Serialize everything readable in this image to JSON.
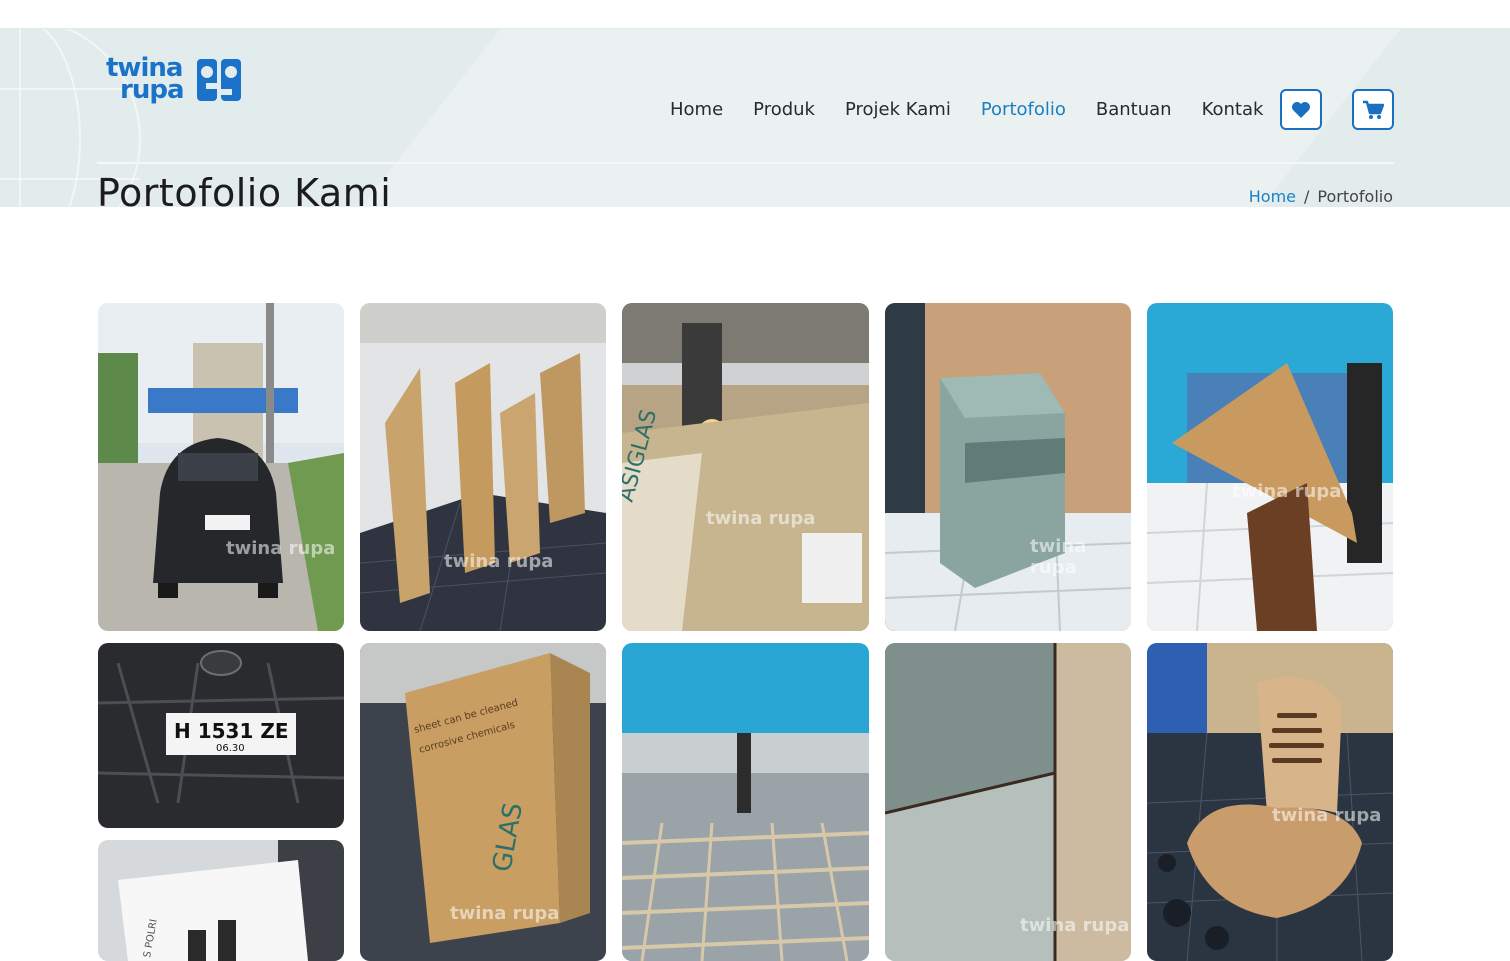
{
  "brand": {
    "line1": "twina",
    "line2": "rupa"
  },
  "nav": {
    "items": [
      {
        "label": "Home"
      },
      {
        "label": "Produk"
      },
      {
        "label": "Projek Kami"
      },
      {
        "label": "Portofolio",
        "active": true
      },
      {
        "label": "Bantuan"
      },
      {
        "label": "Kontak"
      }
    ],
    "wishlist_icon": "heart-icon",
    "cart_icon": "cart-icon"
  },
  "page": {
    "title": "Portofolio Kami"
  },
  "breadcrumb": {
    "home": "Home",
    "separator": "/",
    "current": "Portofolio"
  },
  "gallery": {
    "watermark": "twina rupa",
    "plates": {
      "plate1": "H 1531 ZE",
      "plate1_sub": "06.30",
      "plate2": "H 1531 ZE",
      "plate2_sub": "06.30",
      "polri": "S POLRI"
    },
    "sheet_brand": "GLAS",
    "sheet_brand2": "ASIGLAS"
  },
  "colors": {
    "accent": "#1b7fc4",
    "hero_bg": "#e3ecec",
    "icon_border": "#1b6fc1"
  }
}
